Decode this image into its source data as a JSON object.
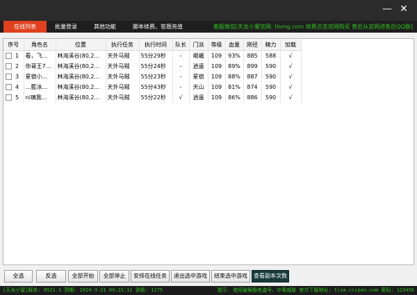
{
  "window": {
    "minimize_glyph": "—",
    "close_glyph": "✕"
  },
  "tabs": [
    {
      "label": "在线列表",
      "active": true
    },
    {
      "label": "批量登录",
      "active": false
    },
    {
      "label": "其他功能",
      "active": false
    },
    {
      "label": "脚本续费、答题充值",
      "active": false
    }
  ],
  "notice": "客服微信[天龙小蜜官网: tlsmg.com 续费点击官网购买 售后从官网进售后QQ群]",
  "table": {
    "columns": [
      "序号",
      "角色名",
      "位置",
      "执行任务",
      "执行时间",
      "队长",
      "门派",
      "等级",
      "血量",
      "刚径",
      "精力",
      "加载"
    ],
    "rows": [
      {
        "idx": "1",
        "name": "看，飞…",
        "location": "林海溪谷(80,2…",
        "task": "天外马贼",
        "time": "55分29秒",
        "leader": "-",
        "sect": "峨嵋",
        "level": "109",
        "hp": "93%",
        "gang": "885",
        "energy": "588",
        "loaded": "√"
      },
      {
        "idx": "2",
        "name": "你哥王7…",
        "location": "林海溪谷(80,2…",
        "task": "天外马贼",
        "time": "55分24秒",
        "leader": "-",
        "sect": "逍遥",
        "level": "109",
        "hp": "89%",
        "gang": "899",
        "energy": "590",
        "loaded": "√"
      },
      {
        "idx": "3",
        "name": "星宿小…",
        "location": "林海溪谷(80,2…",
        "task": "天外马贼",
        "time": "55分23秒",
        "leader": "-",
        "sect": "星宿",
        "level": "109",
        "hp": "88%",
        "gang": "887",
        "energy": "590",
        "loaded": "√"
      },
      {
        "idx": "4",
        "name": "…藍冰…",
        "location": "林海溪谷(80,2…",
        "task": "天外马贼",
        "time": "55分43秒",
        "leader": "-",
        "sect": "天山",
        "level": "109",
        "hp": "81%",
        "gang": "874",
        "energy": "590",
        "loaded": "√"
      },
      {
        "idx": "5",
        "name": "ni璃我…",
        "location": "林海溪谷(80,2…",
        "task": "天外马贼",
        "time": "55分22秒",
        "leader": "√",
        "sect": "逍遥",
        "level": "109",
        "hp": "86%",
        "gang": "886",
        "energy": "590",
        "loaded": "√"
      }
    ]
  },
  "buttons": {
    "select_all": "全选",
    "invert": "反选",
    "start_all": "全部开始",
    "stop_all": "全部停止",
    "arrange_tasks": "安排在线任务",
    "exit_selected": "退出选中游戏",
    "end_selected": "结束选中游戏",
    "view_dungeon": "查看副本次数"
  },
  "status": {
    "left": "[天龙小蜜]版本: 0521.1  到期: 2024-3-21 09:22:11  答题: 1175",
    "right": "提示: 使用破解版有盗号、中毒威胁 官方下载地址: tlsm.cccpan.com 密码: 123456"
  },
  "colors": {
    "accent_tab": "#e0401e",
    "notice_text": "#31c41f",
    "titlebar": "#2b2b2b",
    "dark_button": "#173a3a"
  }
}
